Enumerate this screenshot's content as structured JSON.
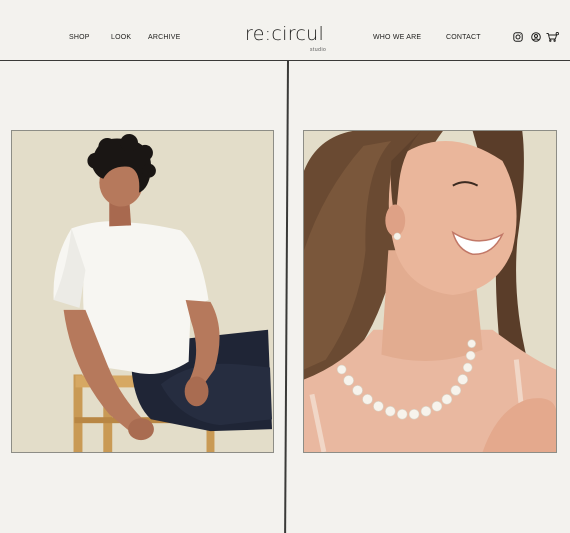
{
  "nav_left": [
    "SHOP",
    "LOOK",
    "ARCHIVE"
  ],
  "nav_right": [
    "WHO WE ARE",
    "CONTACT"
  ],
  "brand": {
    "name": "re:circul",
    "subtitle": "studio"
  },
  "header_icons": [
    "instagram-icon",
    "account-icon",
    "cart-icon"
  ],
  "colors": {
    "background": "#f3f2ee",
    "photo_backdrop": "#e3ddc9",
    "rule": "#3a3a38"
  },
  "photos": [
    {
      "subject": "man in white t-shirt sitting on wooden stool"
    },
    {
      "subject": "smiling woman wearing pearl necklace and earring"
    }
  ]
}
